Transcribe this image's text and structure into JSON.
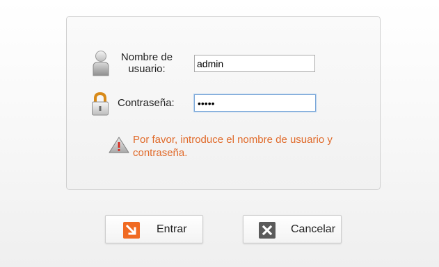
{
  "login": {
    "username_label": "Nombre de usuario:",
    "username_value": "admin",
    "password_label": "Contraseña:",
    "password_value": "•••••",
    "warning_message": "Por favor, introduce el nombre de usuario y contraseña."
  },
  "buttons": {
    "enter_label": "Entrar",
    "cancel_label": "Cancelar"
  },
  "icons": {
    "user": "user-icon",
    "lock": "lock-icon",
    "warning": "warning-icon",
    "enter": "enter-arrow-icon",
    "cancel": "close-icon"
  },
  "colors": {
    "warning_text": "#e06a2a",
    "enter_icon": "#f06a22",
    "cancel_icon": "#5a5a5a",
    "lock_shackle": "#d88a19",
    "focus_border": "#7aa7d8"
  }
}
